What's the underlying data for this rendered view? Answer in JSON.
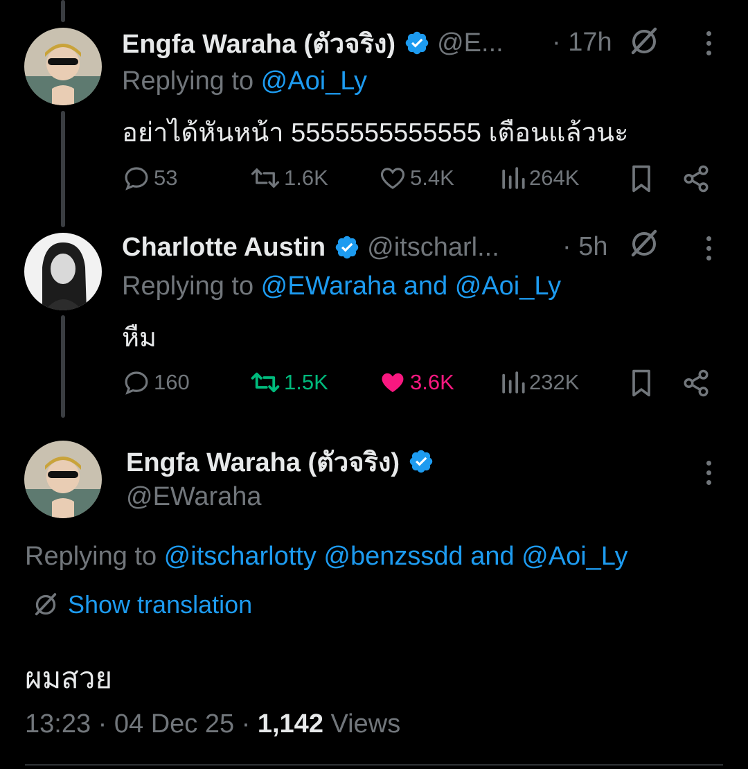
{
  "tweets": [
    {
      "author": "Engfa Waraha (ตัวจริง)",
      "handle": "@E...",
      "time": "· 17h",
      "reply_prefix": "Replying to ",
      "reply_to": "@Aoi_Ly",
      "text": "อย่าได้หันหน้า 5555555555555 เตือนแล้วนะ",
      "replies": "53",
      "retweets": "1.6K",
      "likes": "5.4K",
      "views": "264K",
      "liked": false,
      "retweeted": false
    },
    {
      "author": "Charlotte Austin",
      "handle": "@itscharl...",
      "time": "· 5h",
      "reply_prefix": "Replying to ",
      "reply_to": "@EWaraha and @Aoi_Ly",
      "text": "หืม",
      "replies": "160",
      "retweets": "1.5K",
      "likes": "3.6K",
      "views": "232K",
      "liked": true,
      "retweeted": true
    }
  ],
  "main_tweet": {
    "author": "Engfa Waraha (ตัวจริง)",
    "handle": "@EWaraha",
    "reply_prefix": "Replying to ",
    "reply_to": "@itscharlotty @benzssdd and @Aoi_Ly",
    "show_translation": "Show translation",
    "text": "ผมสวย",
    "timestamp": "13:23 · 04 Dec 25 · ",
    "views_count": "1,142",
    "views_label": " Views"
  },
  "colors": {
    "background": "#000000",
    "text": "#e7e9ea",
    "muted": "#71767b",
    "link": "#1d9bf0",
    "like": "#f91880",
    "retweet": "#00ba7c",
    "verified": "#1d9bf0"
  },
  "icons": [
    "reply-icon",
    "retweet-icon",
    "like-icon",
    "views-icon",
    "bookmark-icon",
    "share-icon",
    "grok-icon",
    "more-icon",
    "verified-icon",
    "translate-icon"
  ]
}
